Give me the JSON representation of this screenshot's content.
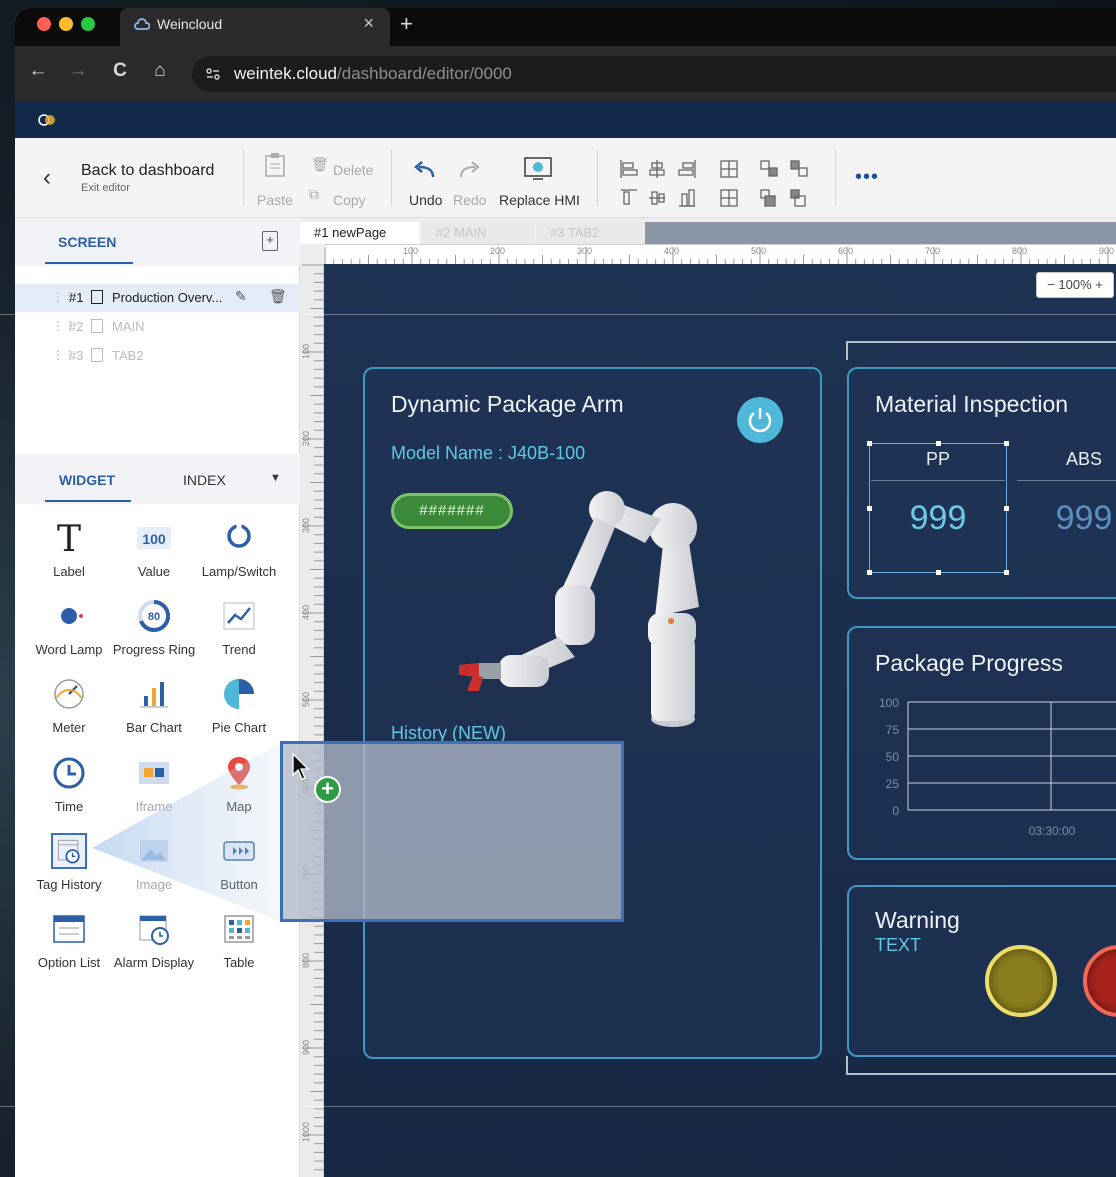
{
  "browser": {
    "tab_title": "Weincloud",
    "tab_close": "×",
    "new_tab": "+",
    "url_host": "weintek.cloud",
    "url_path": "/dashboard/editor/0000",
    "nav": {
      "back": "←",
      "forward": "→",
      "reload": "C",
      "home": "⌂"
    }
  },
  "toolbar": {
    "back_title": "Back to dashboard",
    "back_subtitle": "Exit editor",
    "paste": "Paste",
    "delete": "Delete",
    "copy": "Copy",
    "undo": "Undo",
    "redo": "Redo",
    "replace_hmi": "Replace HMI",
    "more": "•••"
  },
  "screen_panel": {
    "tab": "SCREEN",
    "add": "+",
    "pages": [
      {
        "num": "#1",
        "name": "Production Overv...",
        "selected": true
      },
      {
        "num": "#2",
        "name": "MAIN",
        "selected": false
      },
      {
        "num": "#3",
        "name": "TAB2",
        "selected": false
      }
    ]
  },
  "widget_panel": {
    "tab_widget": "WIDGET",
    "tab_index": "INDEX",
    "widgets": [
      {
        "label": "Label",
        "icon": "label-icon"
      },
      {
        "label": "Value",
        "icon": "value-icon",
        "icon_text": "100"
      },
      {
        "label": "Lamp/Switch",
        "icon": "lamp-switch-icon"
      },
      {
        "label": "Word Lamp",
        "icon": "word-lamp-icon"
      },
      {
        "label": "Progress Ring",
        "icon": "progress-ring-icon",
        "icon_text": "80"
      },
      {
        "label": "Trend",
        "icon": "trend-icon"
      },
      {
        "label": "Meter",
        "icon": "meter-icon"
      },
      {
        "label": "Bar Chart",
        "icon": "bar-chart-icon"
      },
      {
        "label": "Pie Chart",
        "icon": "pie-chart-icon"
      },
      {
        "label": "Time",
        "icon": "time-icon"
      },
      {
        "label": "Iframe",
        "icon": "iframe-icon"
      },
      {
        "label": "Map",
        "icon": "map-icon"
      },
      {
        "label": "Tag History",
        "icon": "tag-history-icon"
      },
      {
        "label": "Image",
        "icon": "image-icon"
      },
      {
        "label": "Button",
        "icon": "button-icon"
      },
      {
        "label": "Option List",
        "icon": "option-list-icon"
      },
      {
        "label": "Alarm Display",
        "icon": "alarm-display-icon"
      },
      {
        "label": "Table",
        "icon": "table-icon"
      }
    ]
  },
  "canvas": {
    "tabs": [
      "#1 newPage",
      "#2 MAIN",
      "#3 TAB2"
    ],
    "zoom": "− 100% +",
    "ruler_top": [
      "100",
      "200",
      "300",
      "400",
      "500",
      "600",
      "700",
      "800",
      "900"
    ],
    "ruler_left": [
      "100",
      "200",
      "300",
      "400",
      "500",
      "600",
      "700",
      "800",
      "900",
      "1000"
    ],
    "package_arm": {
      "title": "Dynamic Package Arm",
      "model": "Model Name : J40B-100",
      "pill": "#######",
      "history": "History (NEW)"
    },
    "material": {
      "title": "Material Inspection",
      "columns": [
        {
          "name": "PP",
          "value": "999"
        },
        {
          "name": "ABS",
          "value": "999"
        }
      ]
    },
    "progress": {
      "title": "Package Progress",
      "y_ticks": [
        "100",
        "75",
        "50",
        "25",
        "0"
      ],
      "x_tick": "03:30:00"
    },
    "warning": {
      "title": "Warning",
      "text": "TEXT"
    }
  },
  "colors": {
    "accent": "#2d5fa8",
    "card_border": "#3f98c2",
    "canvas_bg": "#1c2f4f",
    "lamp_yellow": "#8a7e1e",
    "lamp_red": "#a8231e"
  }
}
